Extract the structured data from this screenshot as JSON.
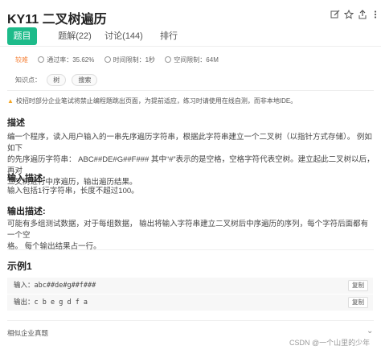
{
  "header": {
    "title": "KY11  二叉树遍历",
    "icons": [
      "edit-icon",
      "star-icon",
      "share-icon",
      "more-icon"
    ]
  },
  "tabs": [
    {
      "label": "题目",
      "active": true
    },
    {
      "label": "题解(22)",
      "active": false
    },
    {
      "label": "讨论(144)",
      "active": false
    },
    {
      "label": "排行",
      "active": false
    }
  ],
  "meta": {
    "difficulty": "较难",
    "pass_rate": "通过率：35.62%",
    "time_limit": "时间限制：1秒",
    "space_limit": "空间限制：64M"
  },
  "knowledge": {
    "label": "知识点：",
    "tags": [
      "树",
      "搜索"
    ]
  },
  "notice": "校招时部分企业笔试将禁止编程题跳出页面，为提前适应，练习时请使用在线自测，而非本地IDE。",
  "description": {
    "heading": "描述",
    "line1": "编一个程序，读入用户输入的一串先序遍历字符串，根据此字符串建立一个二叉树（以指针方式存储）。 例如如下",
    "line2": "的先序遍历字符串： ABC##DE#G##F### 其中“#”表示的是空格，空格字符代表空树。建立起此二叉树以后，再对",
    "line3": "二叉树进行中序遍历，输出遍历结果。"
  },
  "input_desc": {
    "heading": "输入描述:",
    "text": "输入包括1行字符串，长度不超过100。"
  },
  "output_desc": {
    "heading": "输出描述:",
    "line1": "可能有多组测试数据，对于每组数据， 输出将输入字符串建立二叉树后中序遍历的序列，每个字符后面都有一个空",
    "line2": "格。 每个输出结果占一行。"
  },
  "example": {
    "title": "示例1",
    "input_label": "输入：",
    "input_value": "abc##de#g##f###",
    "output_label": "输出：",
    "output_value": "c b e g d f a",
    "copy_label": "复制"
  },
  "related": "相似企业真题",
  "watermark": "CSDN @一个山里的少年"
}
